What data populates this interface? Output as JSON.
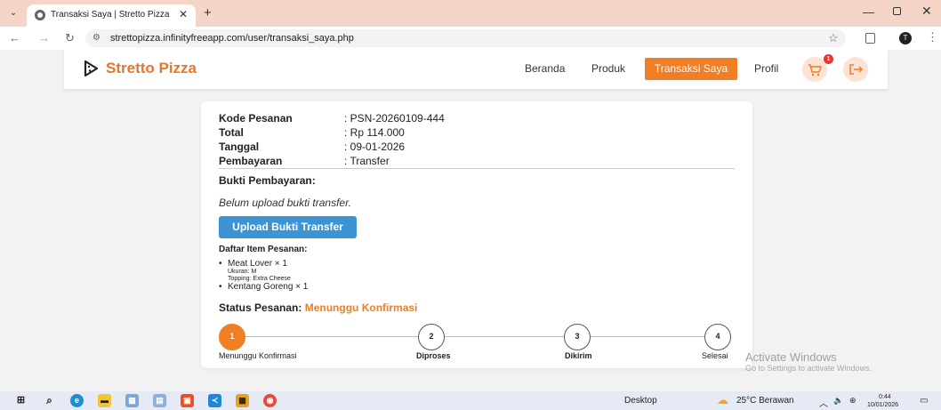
{
  "browser": {
    "tab_title": "Transaksi Saya | Stretto Pizza",
    "url": "strettopizza.infinityfreeapp.com/user/transaksi_saya.php",
    "profile_initial": "T"
  },
  "navbar": {
    "brand": "Stretto Pizza",
    "links": [
      "Beranda",
      "Produk",
      "Transaksi Saya",
      "Profil"
    ],
    "active_link": "Transaksi Saya",
    "cart_count": "1",
    "accent_color": "#ef7e24"
  },
  "order": {
    "labels": {
      "code": "Kode Pesanan",
      "total": "Total",
      "date": "Tanggal",
      "payment": "Pembayaran"
    },
    "values": {
      "code": ": PSN-20260109-444",
      "total": ": Rp 114.000",
      "date": ": 09-01-2026",
      "payment": ": Transfer"
    },
    "proof_title": "Bukti Pembayaran:",
    "proof_note": "Belum upload bukti transfer.",
    "upload_button": "Upload Bukti Transfer",
    "items_title": "Daftar Item Pesanan:",
    "items": [
      {
        "name": "Meat Lover × 1",
        "size": "Ukuran: M",
        "topping": "Topping: Extra Cheese"
      },
      {
        "name": "Kentang Goreng × 1"
      }
    ],
    "status_label": "Status Pesanan:",
    "status_value": "Menunggu Konfirmasi",
    "steps": [
      {
        "num": "1",
        "label": "Menunggu Konfirmasi"
      },
      {
        "num": "2",
        "label": "Diproses"
      },
      {
        "num": "3",
        "label": "Dikirim"
      },
      {
        "num": "4",
        "label": "Selesai"
      }
    ]
  },
  "watermark": {
    "line1": "Activate Windows",
    "line2": "Go to Settings to activate Windows."
  },
  "taskbar": {
    "desktop_label": "Desktop",
    "weather": "25°C  Berawan",
    "time": "0:44",
    "date": "10/01/2026"
  }
}
